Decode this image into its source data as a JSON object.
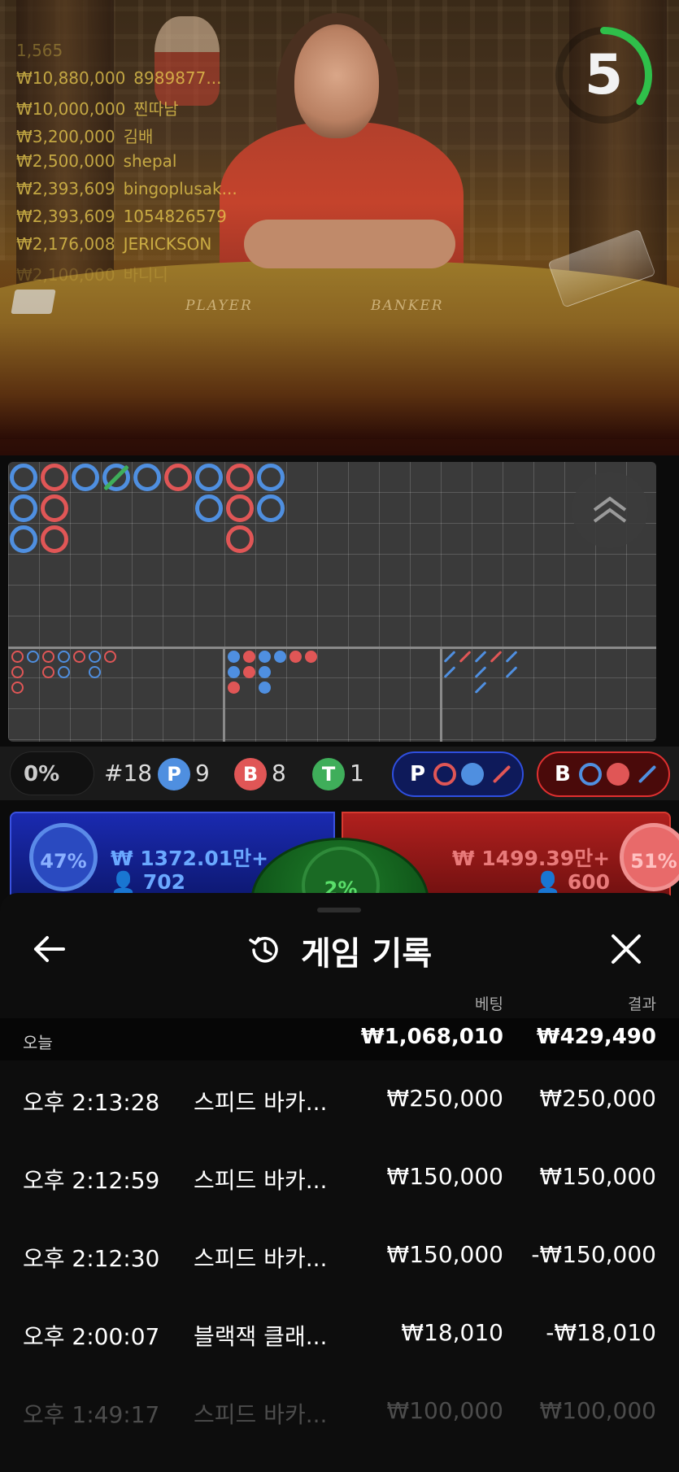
{
  "video": {
    "timer": "5",
    "timer_fraction": 0.35,
    "table_labels": [
      "PLAYER",
      "BANKER"
    ],
    "winners": [
      {
        "amount": "1,565",
        "name": ""
      },
      {
        "amount": "₩10,880,000",
        "name": "8989877..."
      },
      {
        "amount": "₩10,000,000",
        "name": "찐따남"
      },
      {
        "amount": "₩3,200,000",
        "name": "김배"
      },
      {
        "amount": "₩2,500,000",
        "name": "shepal"
      },
      {
        "amount": "₩2,393,609",
        "name": "bingoplusak..."
      },
      {
        "amount": "₩2,393,609",
        "name": "1054826579"
      },
      {
        "amount": "₩2,176,008",
        "name": "JERICKSON"
      },
      {
        "amount": "₩2,100,000",
        "name": "바니니"
      }
    ]
  },
  "roadmap": {
    "bead_columns": [
      [
        "p",
        "p",
        "p"
      ],
      [
        "b",
        "b",
        "b"
      ],
      [
        "p"
      ],
      [
        "tie"
      ],
      [
        "p"
      ],
      [
        "b"
      ],
      [
        "p",
        "p"
      ],
      [
        "b",
        "b",
        "b"
      ],
      [
        "p",
        "p"
      ]
    ]
  },
  "stats": {
    "percent": "0%",
    "round": "#18",
    "player_letter": "P",
    "player_count": "9",
    "banker_letter": "B",
    "banker_count": "8",
    "tie_letter": "T",
    "tie_count": "1",
    "player_pred_label": "P",
    "banker_pred_label": "B"
  },
  "bets": {
    "player_pct": "47%",
    "player_amount": "₩ 1372.01만+",
    "player_users": "702",
    "banker_pct": "51%",
    "banker_amount": "₩ 1499.39만+",
    "banker_users": "600",
    "tie_pct": "2%"
  },
  "history": {
    "title": "게임 기록",
    "col_bet": "베팅",
    "col_result": "결과",
    "today_label": "오늘",
    "today_bet": "₩1,068,010",
    "today_result": "₩429,490",
    "rows": [
      {
        "time": "오후 2:13:28",
        "game": "스피드 바카...",
        "bet": "₩250,000",
        "result": "₩250,000"
      },
      {
        "time": "오후 2:12:59",
        "game": "스피드 바카...",
        "bet": "₩150,000",
        "result": "₩150,000"
      },
      {
        "time": "오후 2:12:30",
        "game": "스피드 바카...",
        "bet": "₩150,000",
        "result": "-₩150,000"
      },
      {
        "time": "오후 2:00:07",
        "game": "블랙잭 클래...",
        "bet": "₩18,010",
        "result": "-₩18,010"
      },
      {
        "time": "오후 1:49:17",
        "game": "스피드 바카...",
        "bet": "₩100,000",
        "result": "₩100,000"
      }
    ]
  },
  "colors": {
    "player": "#4f8fe0",
    "banker": "#e05656",
    "tie": "#3fae5a",
    "timer_arc": "#2fbf4a"
  }
}
